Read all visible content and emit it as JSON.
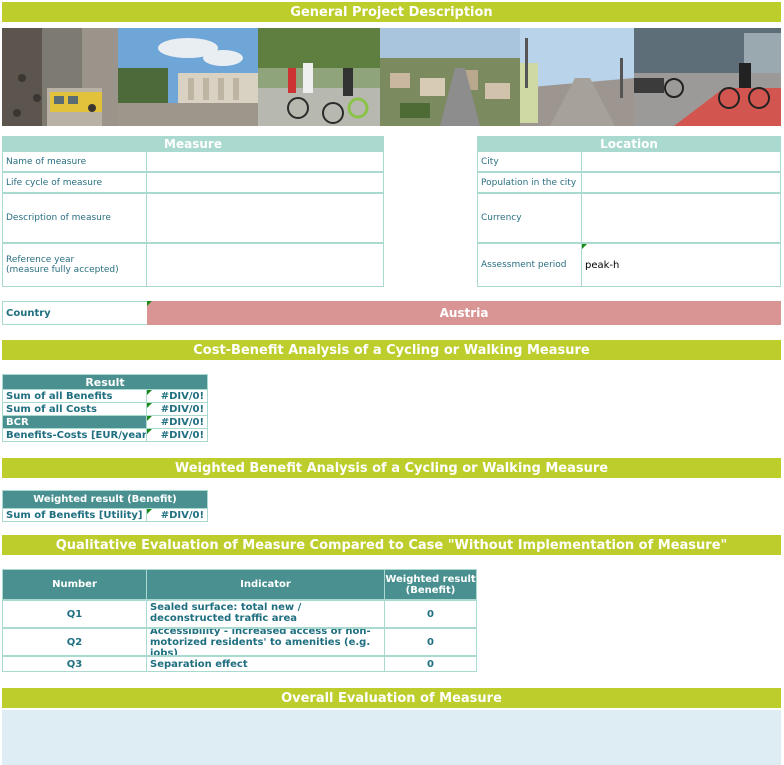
{
  "sections": {
    "general": "General Project Description",
    "cba": "Cost-Benefit Analysis of a Cycling or Walking Measure",
    "weighted": "Weighted Benefit Analysis of a Cycling or Walking Measure",
    "qualitative": "Qualitative Evaluation of Measure Compared to Case \"Without Implementation of Measure\"",
    "overall": "Overall Evaluation of Measure"
  },
  "measure": {
    "header": "Measure",
    "rows": [
      {
        "label": "Name of measure",
        "value": ""
      },
      {
        "label": "Life cycle of measure",
        "value": ""
      },
      {
        "label": "Description of measure",
        "value": ""
      },
      {
        "label": "Reference year\n(measure fully accepted)",
        "value": ""
      }
    ]
  },
  "location": {
    "header": "Location",
    "rows": [
      {
        "label": "City",
        "value": ""
      },
      {
        "label": "Population in the city",
        "value": ""
      },
      {
        "label": "Currency",
        "value": ""
      },
      {
        "label": "Assessment period",
        "value": "peak-h"
      }
    ]
  },
  "country": {
    "label": "Country",
    "value": "Austria"
  },
  "result": {
    "header": "Result",
    "rows": [
      {
        "label": "Sum of all Benefits",
        "value": "#DIV/0!"
      },
      {
        "label": "Sum of all Costs",
        "value": "#DIV/0!"
      },
      {
        "label": "BCR",
        "value": "#DIV/0!"
      },
      {
        "label": "Benefits-Costs [EUR/year]",
        "value": "#DIV/0!"
      }
    ]
  },
  "weighted_result": {
    "header": "Weighted result (Benefit)",
    "label": "Sum of Benefits [Utility]",
    "value": "#DIV/0!"
  },
  "qualitative_table": {
    "headers": {
      "number": "Number",
      "indicator": "Indicator",
      "weighted": "Weighted result (Benefit)"
    },
    "rows": [
      {
        "number": "Q1",
        "indicator": "Sealed surface: total new / deconstructed traffic area",
        "value": "0"
      },
      {
        "number": "Q2",
        "indicator": "Accessibility - increased access of non-motorized residents' to amenities (e.g. jobs)",
        "value": "0"
      },
      {
        "number": "Q3",
        "indicator": "Separation effect",
        "value": "0"
      }
    ]
  },
  "colors": {
    "banner": "#bccd2c",
    "measure_header": "#a9d9cf",
    "result_header": "#4a9090",
    "country_value": "#d99594",
    "overall_area": "#ddedf3"
  },
  "icons": [
    "photo-pedestrian-street",
    "photo-city-square",
    "photo-cyclists",
    "photo-city-aerial",
    "photo-walkway",
    "photo-bike-lane"
  ]
}
